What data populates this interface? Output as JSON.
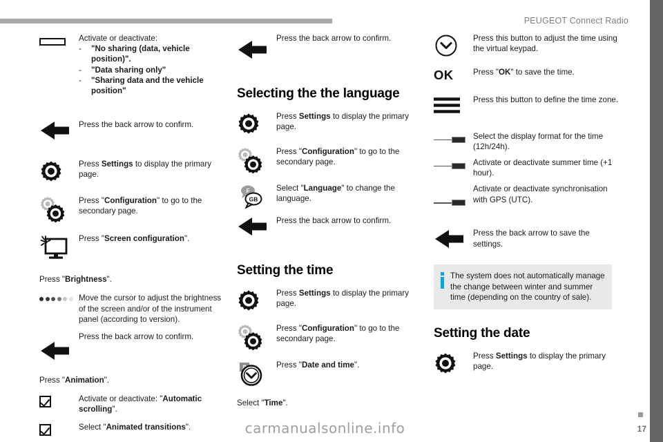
{
  "header": {
    "title": "PEUGEOT Connect Radio"
  },
  "footer": {
    "watermark": "carmanualsonline.info",
    "page_number": "17"
  },
  "column1": {
    "intro_label": "Activate or deactivate:",
    "bullets": [
      "\"No sharing (data, vehicle position)\".",
      "\"Data sharing only\"",
      "\"Sharing data and the vehicle position\""
    ],
    "rows": [
      {
        "icon": "back-arrow-icon",
        "text_html": "Press the back arrow to confirm."
      },
      {
        "icon": "settings-gear-icon",
        "text_html": "Press <b>Settings</b> to display the primary page."
      },
      {
        "icon": "configuration-gears-icon",
        "text_html": "Press \"<b>Configuration</b>\" to go to the secondary page."
      },
      {
        "icon": "screen-brightness-monitor-icon",
        "text_html": "Press \"<b>Screen configuration</b>\"."
      }
    ],
    "press_brightness": "Press \"<b>Brightness</b>\".",
    "brightness_row": {
      "icon": "brightness-dots-icon",
      "text_html": "Move the cursor to adjust the brightness of the screen and/or of the instrument panel (according to version)."
    },
    "back_row": {
      "icon": "back-arrow-icon",
      "text_html": "Press the back arrow to confirm."
    },
    "press_animation": "Press \"<b>Animation</b>\".",
    "animation_rows": [
      {
        "icon": "checkbox-checked-icon",
        "text_html": "Activate or deactivate: \"<b>Automatic scrolling</b>\"."
      },
      {
        "icon": "checkbox-checked-icon",
        "text_html": "Select \"<b>Animated transitions</b>\"."
      }
    ]
  },
  "column2": {
    "back_row_top": {
      "icon": "back-arrow-icon",
      "text_html": "Press the back arrow to confirm."
    },
    "heading_language": "Selecting the the language",
    "language_rows": [
      {
        "icon": "settings-gear-icon",
        "text_html": "Press <b>Settings</b> to display the primary page."
      },
      {
        "icon": "configuration-gears-icon",
        "text_html": "Press \"<b>Configuration</b>\" to go to the secondary page."
      },
      {
        "icon": "language-speech-bubbles-icon",
        "text_html": "Select \"<b>Language</b>\" to change the language."
      },
      {
        "icon": "back-arrow-icon",
        "text_html": "Press the back arrow to confirm."
      }
    ],
    "language_bubble_labels": [
      "F",
      "GB"
    ],
    "heading_time": "Setting the time",
    "time_rows": [
      {
        "icon": "settings-gear-icon",
        "text_html": "Press <b>Settings</b> to display the primary page."
      },
      {
        "icon": "configuration-gears-icon",
        "text_html": "Press \"<b>Configuration</b>\" to go to the secondary page."
      },
      {
        "icon": "date-and-time-clock-icon",
        "text_html": "Press \"<b>Date and time</b>\"."
      }
    ],
    "clock_badge": "8",
    "select_time": "Select \"<b>Time</b>\"."
  },
  "column3": {
    "rows": [
      {
        "icon": "chevron-down-circle-icon",
        "text_html": "Press this button to adjust the time using the virtual keypad."
      },
      {
        "icon": "ok-icon",
        "text_html": "Press \"<b>OK</b>\" to save the time."
      },
      {
        "icon": "time-zone-bars-icon",
        "text_html": "Press this button to define the time zone."
      },
      {
        "icon": "slider-icon",
        "text_html": "Select the display format for the time (12h/24h)."
      },
      {
        "icon": "slider-icon",
        "text_html": "Activate or deactivate summer time (+1 hour)."
      },
      {
        "icon": "slider-icon",
        "text_html": "Activate or deactivate synchronisation with GPS (UTC)."
      },
      {
        "icon": "back-arrow-icon",
        "text_html": "Press the back arrow to save the settings."
      }
    ],
    "ok_icon_label": "OK",
    "info_note": "The system does not automatically manage the change between winter and summer time (depending on the country of sale).",
    "heading_date": "Setting the date",
    "date_row": {
      "icon": "settings-gear-icon",
      "text_html": "Press <b>Settings</b> to display the primary page."
    }
  },
  "colors": {
    "rule": "#a8a8a8",
    "gutter": "#636363",
    "header_text": "#7d7d7d",
    "info_accent": "#1b9fd0",
    "info_bg": "#e9e9e9",
    "body_text": "#1a1a1a"
  }
}
